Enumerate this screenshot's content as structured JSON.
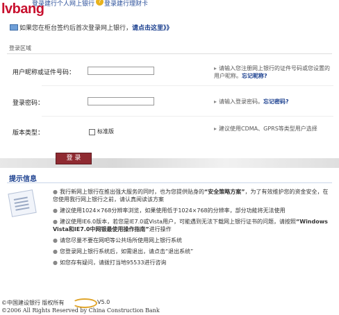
{
  "header": {
    "logo": "lvbang",
    "link1": "登录建行个人网上银行",
    "link2": "登录建行理财卡",
    "badge": "?"
  },
  "notice": {
    "text": "如果您在柜台签约后首次登录网上银行，",
    "link": "请点击这里》》"
  },
  "login": {
    "section_title": "登录区域",
    "fields": [
      {
        "label": "用户昵称或证件号码：",
        "hint": "请输入您注册网上银行的证件号码或您设置的用户昵称。",
        "hint_link": "忘记昵称?"
      },
      {
        "label": "登录密码：",
        "hint": "请输入登录密码。",
        "hint_link": "忘记密码?"
      }
    ],
    "version_label": "版本类型：",
    "version_option": "标准版",
    "version_hint": "建议使用CDMA、GPRS等类型用户选择",
    "button": "登 录"
  },
  "tips": {
    "title": "提示信息",
    "items": [
      {
        "pre": "我行新网上银行在推出强大服务的同时，也为您提供贴身的",
        "strong": "“安全策略方案”",
        "post": "，为了有效维护您的资金安全，在您使用我行网上银行之前，请认真阅读该方案"
      },
      {
        "pre": "建议使用1024×768分辨率浏览，如果使用低于1024×768的分辨率，部分功能将无法使用",
        "strong": "",
        "post": ""
      },
      {
        "pre": "建议使用IE6.0版本，若您是IE7.0或Vista用户，可能遇到无法下载网上银行证书的问题，请按照",
        "strong": "“Windows Vista和IE7.0中网银最使用操作指南”",
        "post": "进行操作"
      },
      {
        "pre": "请您尽量不要在网吧等公共场所使用网上银行系统",
        "strong": "",
        "post": ""
      },
      {
        "pre": "您登录网上银行系统后，如需退出，请点击“退出系统”",
        "strong": "",
        "post": ""
      },
      {
        "pre": "如您存有疑问，请拨打当地95533进行咨询",
        "strong": "",
        "post": ""
      }
    ]
  },
  "footer": {
    "copyright": "©中国建设银行 版权所有",
    "version": "V5.0",
    "line2": "©2006 All Rights Reserved by China Construction Bank"
  }
}
